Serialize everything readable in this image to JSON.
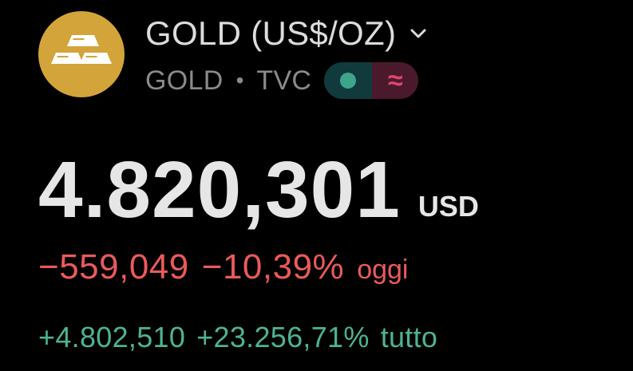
{
  "instrument": {
    "icon": "gold-bars-icon",
    "title": "GOLD (US$/OZ)",
    "symbol": "GOLD",
    "separator": "•",
    "exchange": "TVC",
    "badge_market_open_icon": "green-dot-icon",
    "badge_data_icon": "approx-icon",
    "badge_data_glyph": "≈"
  },
  "quote": {
    "price": "4.820,301",
    "currency": "USD"
  },
  "change_today": {
    "absolute": "−559,049",
    "percent": "−10,39%",
    "period": "oggi"
  },
  "change_all": {
    "absolute": "+4.802,510",
    "percent": "+23.256,71%",
    "period": "tutto"
  },
  "colors": {
    "background": "#000000",
    "logo_gold": "#d3a43a",
    "negative": "#ea5a5a",
    "positive": "#4db394",
    "badge_green_bg": "#113a3c",
    "badge_green_dot": "#3fa58a",
    "badge_red_bg": "#4a1a2c",
    "badge_red_glyph": "#e0456b"
  }
}
